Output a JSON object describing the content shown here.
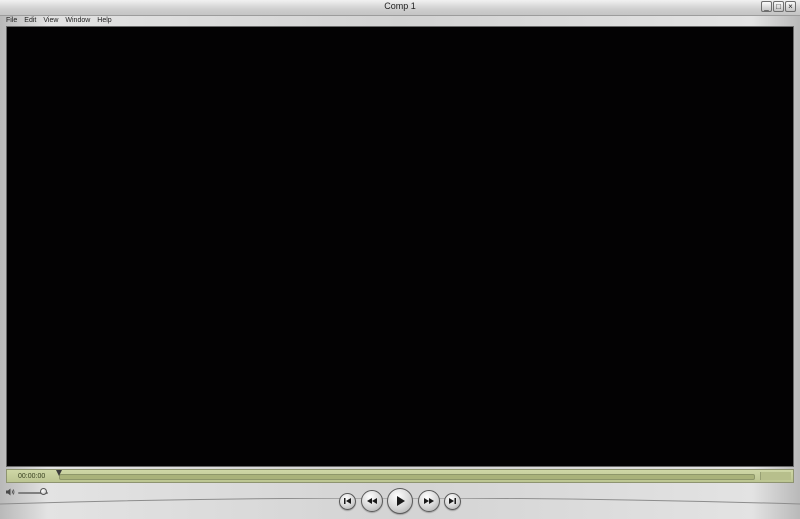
{
  "window": {
    "title": "Comp 1",
    "controls": {
      "minimize": "_",
      "maximize": "□",
      "close": "×"
    }
  },
  "menu": {
    "items": [
      "File",
      "Edit",
      "View",
      "Window",
      "Help"
    ]
  },
  "player": {
    "timecode": "00:00:00",
    "playhead_progress": 0,
    "volume_level": 0.85
  },
  "icons": {
    "speaker": "speaker-icon",
    "go_to_start": "skip-to-start-icon",
    "rewind": "rewind-icon",
    "play": "play-icon",
    "fast_forward": "fast-forward-icon",
    "go_to_end": "skip-to-end-icon"
  },
  "colors": {
    "viewport": "#030203",
    "lcd": "#c8d09e",
    "chrome": "#d3d3d3"
  }
}
